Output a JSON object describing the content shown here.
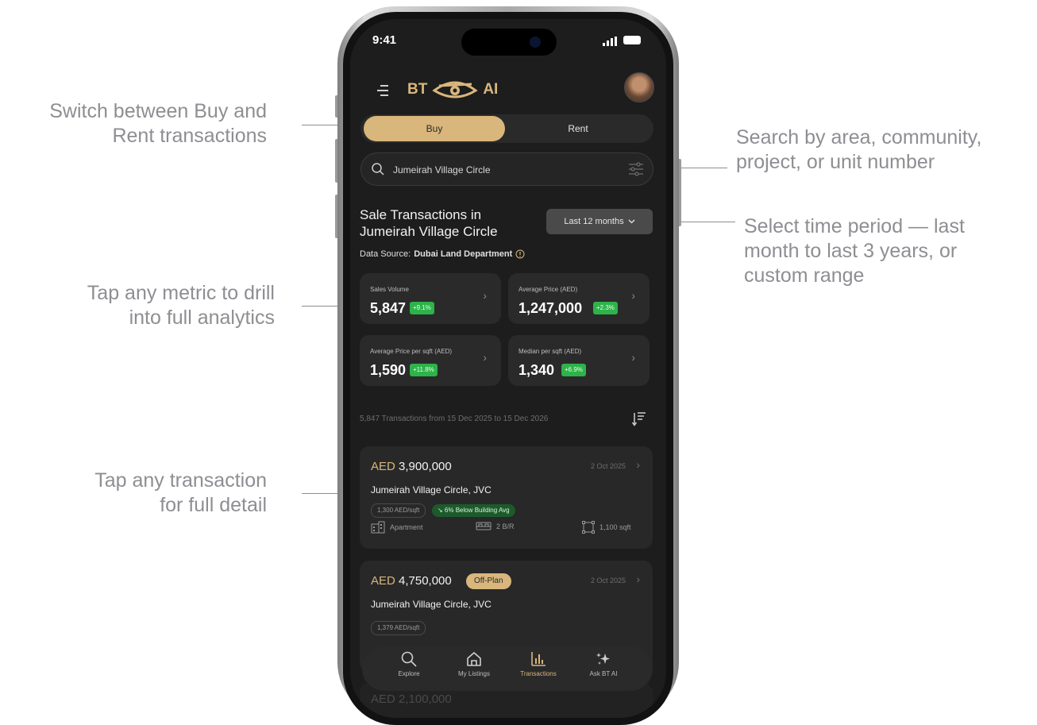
{
  "callouts": {
    "toggle": [
      "Switch between Buy and",
      "Rent transactions"
    ],
    "search": [
      "Search by area, community,",
      "project, or unit number"
    ],
    "period": [
      "Select time period — last",
      "month to last 3 years, or",
      "custom range"
    ],
    "metrics": [
      "Tap any metric to drill",
      "into full analytics"
    ],
    "transaction": [
      "Tap any transaction",
      "for full detail"
    ]
  },
  "status_bar": {
    "time": "9:41"
  },
  "header": {
    "logo_left": "BT",
    "logo_right": "AI"
  },
  "toggle": {
    "buy": "Buy",
    "rent": "Rent",
    "selected": "Buy"
  },
  "search": {
    "value": "Jumeirah Village Circle"
  },
  "section": {
    "title_line1": "Sale Transactions in",
    "title_line2": "Jumeirah Village Circle",
    "period": "Last 12 months",
    "data_source_label": "Data Source:",
    "data_source": "Dubai Land Department"
  },
  "metrics": [
    {
      "label": "Sales Volume",
      "value": "5,847",
      "change": "+9.1%"
    },
    {
      "label": "Average Price (AED)",
      "value": "1,247,000",
      "change": "+2.3%"
    },
    {
      "label": "Average Price per sqft (AED)",
      "value": "1,590",
      "change": "+11.8%"
    },
    {
      "label": "Median per sqft (AED)",
      "value": "1,340",
      "change": "+6.9%"
    }
  ],
  "transactions_summary": "5,847 Transactions from 15 Dec 2025 to 15 Dec 2026",
  "transactions": [
    {
      "currency": "AED",
      "amount": "3,900,000",
      "date": "2 Oct 2025",
      "location": "Jumeirah Village Circle, JVC",
      "price_per_sqft": "1,300 AED/sqft",
      "comparison": "↘ 6% Below Building Avg",
      "type": "Apartment",
      "bedrooms": "2 B/R",
      "size": "1,100 sqft"
    },
    {
      "currency": "AED",
      "amount": "4,750,000",
      "tag": "Off-Plan",
      "date": "2 Oct 2025",
      "location": "Jumeirah Village Circle, JVC",
      "price_per_sqft": "1,379 AED/sqft"
    },
    {
      "currency": "AED",
      "amount": "2,100,000"
    }
  ],
  "nav": [
    {
      "label": "Explore",
      "icon": "search-icon"
    },
    {
      "label": "My Listings",
      "icon": "home-icon"
    },
    {
      "label": "Transactions",
      "icon": "bar-chart-icon",
      "active": true
    },
    {
      "label": "Ask BT AI",
      "icon": "sparkle-icon"
    }
  ],
  "colors": {
    "accent": "#d9b67c",
    "background": "#1d1d1d",
    "card": "#282828",
    "positive": "#2db34a"
  }
}
